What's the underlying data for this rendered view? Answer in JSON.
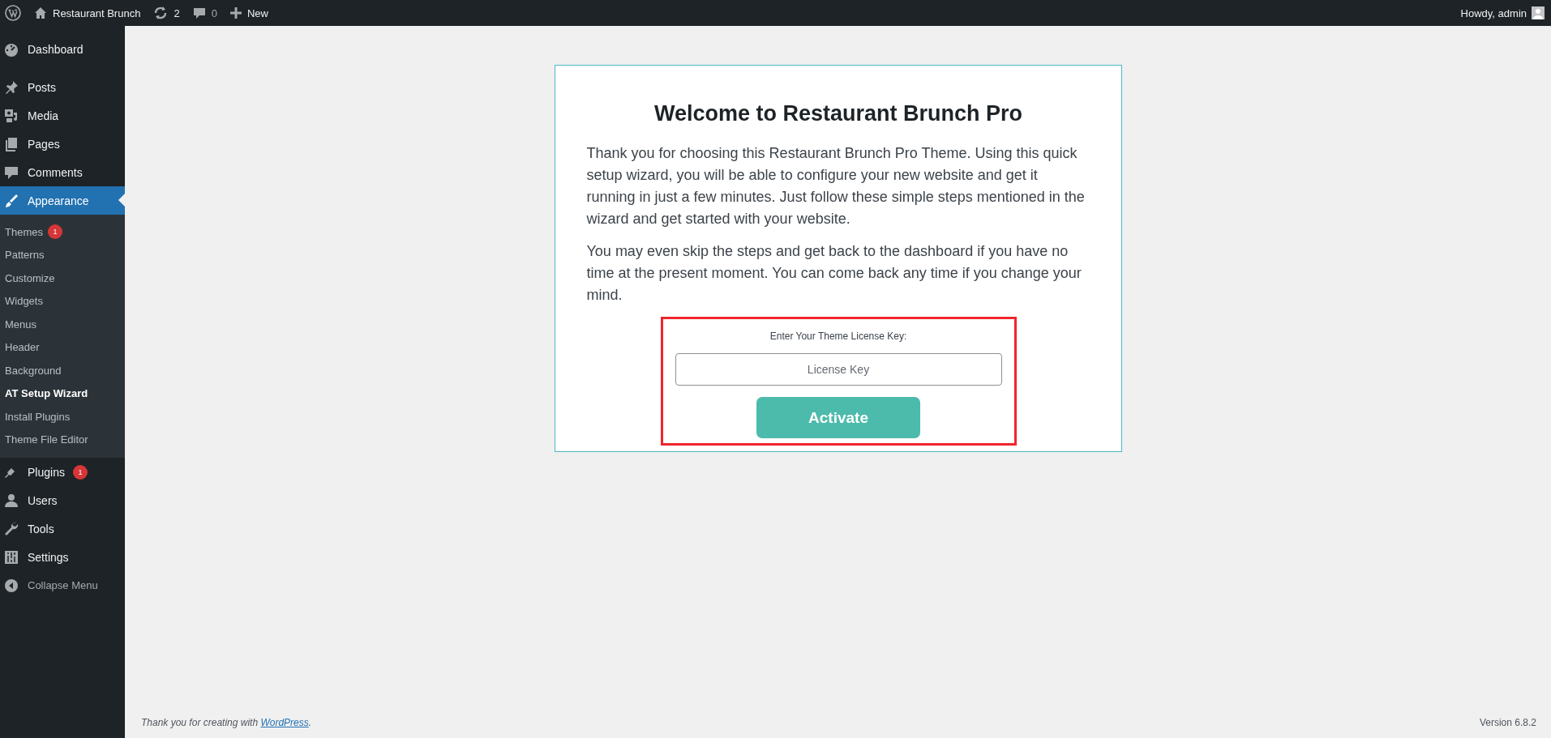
{
  "admin_bar": {
    "site": "Restaurant Brunch",
    "updates": "2",
    "comments": "0",
    "new": "New",
    "greeting": "Howdy, admin"
  },
  "sidebar": {
    "items": [
      {
        "label": "Dashboard",
        "kind": "menu",
        "selected": false
      },
      {
        "label": "Posts",
        "kind": "menu",
        "selected": false
      },
      {
        "label": "Media",
        "kind": "menu",
        "selected": false
      },
      {
        "label": "Pages",
        "kind": "menu",
        "selected": false
      },
      {
        "label": "Comments",
        "kind": "menu",
        "selected": false
      },
      {
        "label": "Appearance",
        "kind": "menu",
        "selected": true,
        "children": [
          {
            "label": "Themes",
            "selected": false,
            "badge": "1"
          },
          {
            "label": "Patterns",
            "selected": false
          },
          {
            "label": "Customize",
            "selected": false
          },
          {
            "label": "Widgets",
            "selected": false
          },
          {
            "label": "Menus",
            "selected": false
          },
          {
            "label": "Header",
            "selected": false
          },
          {
            "label": "Background",
            "selected": false
          },
          {
            "label": "AT Setup Wizard",
            "selected": true
          },
          {
            "label": "Install Plugins",
            "selected": false
          },
          {
            "label": "Theme File Editor",
            "selected": false
          }
        ]
      },
      {
        "label": "Plugins",
        "kind": "menu",
        "selected": false,
        "badge": "1"
      },
      {
        "label": "Users",
        "kind": "menu",
        "selected": false
      },
      {
        "label": "Tools",
        "kind": "menu",
        "selected": false
      },
      {
        "label": "Settings",
        "kind": "menu",
        "selected": false
      },
      {
        "label": "Collapse Menu",
        "kind": "collapse"
      }
    ]
  },
  "wizard": {
    "title": "Welcome to Restaurant Brunch Pro",
    "paragraphs": [
      "Thank you for choosing this Restaurant Brunch Pro Theme. Using this quick setup wizard, you will be able to configure your new website and get it running in just a few minutes. Just follow these simple steps mentioned in the wizard and get started with your website.",
      "You may even skip the steps and get back to the dashboard if you have no time at the present moment. You can come back any time if you change your mind."
    ],
    "license_label": "Enter Your Theme License Key:",
    "license_field": {
      "placeholder": "License Key"
    },
    "button": "Activate"
  },
  "footer": {
    "thanks": "Thank you for creating with",
    "link": "WordPress",
    "period": ".",
    "version": "Version 6.8.2"
  }
}
